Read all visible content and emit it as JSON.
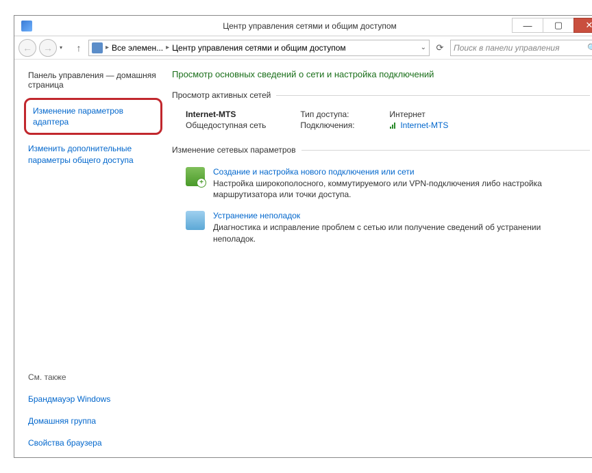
{
  "window": {
    "title": "Центр управления сетями и общим доступом"
  },
  "nav": {
    "breadcrumb": {
      "item1": "Все элемен...",
      "item2": "Центр управления сетями и общим доступом"
    },
    "search_placeholder": "Поиск в панели управления"
  },
  "sidebar": {
    "home": "Панель управления — домашняя страница",
    "adapter_settings": "Изменение параметров адаптера",
    "advanced_sharing": "Изменить дополнительные параметры общего доступа",
    "see_also_label": "См. также",
    "firewall": "Брандмауэр Windows",
    "homegroup": "Домашняя группа",
    "browser_props": "Свойства браузера"
  },
  "main": {
    "heading": "Просмотр основных сведений о сети и настройка подключений",
    "section_active": "Просмотр активных сетей",
    "network": {
      "name": "Internet-MTS",
      "type": "Общедоступная сеть",
      "access_label": "Тип доступа:",
      "access_value": "Интернет",
      "conn_label": "Подключения:",
      "conn_value": "Internet-MTS"
    },
    "section_change": "Изменение сетевых параметров",
    "task_new": {
      "title": "Создание и настройка нового подключения или сети",
      "desc": "Настройка широкополосного, коммутируемого или VPN-подключения либо настройка маршрутизатора или точки доступа."
    },
    "task_troubleshoot": {
      "title": "Устранение неполадок",
      "desc": "Диагностика и исправление проблем с сетью или получение сведений об устранении неполадок."
    }
  }
}
